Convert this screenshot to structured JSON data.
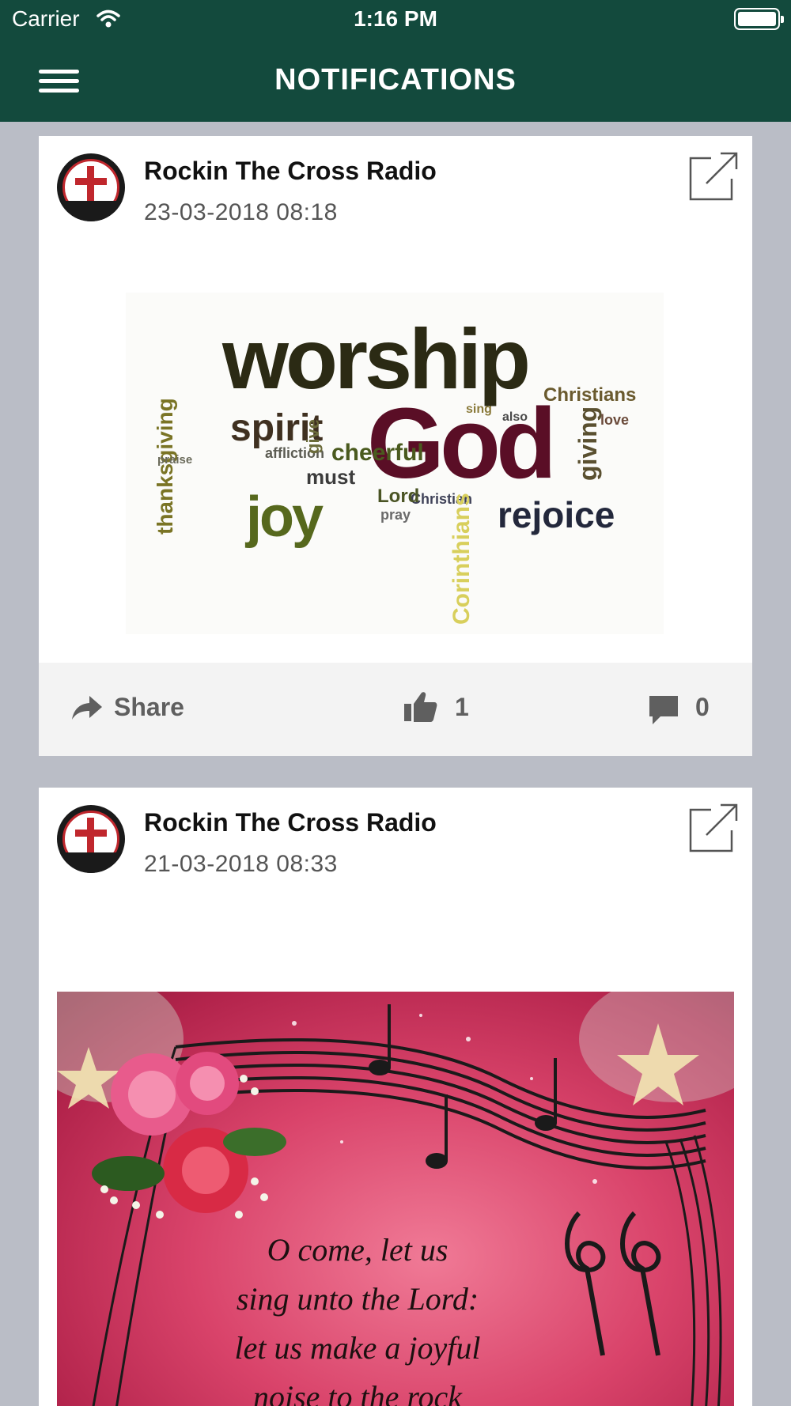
{
  "status_bar": {
    "carrier": "Carrier",
    "time": "1:16 PM"
  },
  "nav": {
    "title": "NOTIFICATIONS"
  },
  "posts": [
    {
      "author": "Rockin The Cross Radio",
      "date": "23-03-2018 08:18",
      "image": {
        "words": [
          "worship",
          "God",
          "spirit",
          "joy",
          "rejoice",
          "cheerful",
          "thanksgiving",
          "giving",
          "Christians",
          "Christian",
          "affliction",
          "must",
          "Lord",
          "pray",
          "Corinthians",
          "give",
          "also",
          "sing",
          "praise",
          "love"
        ]
      },
      "actions": {
        "share_label": "Share",
        "likes": "1",
        "comments": "0"
      }
    },
    {
      "author": "Rockin The Cross Radio",
      "date": "21-03-2018 08:33",
      "image": {
        "lines": [
          "O come, let us",
          "sing unto the Lord:",
          "let us make a joyful",
          "noise to the rock"
        ]
      }
    }
  ]
}
